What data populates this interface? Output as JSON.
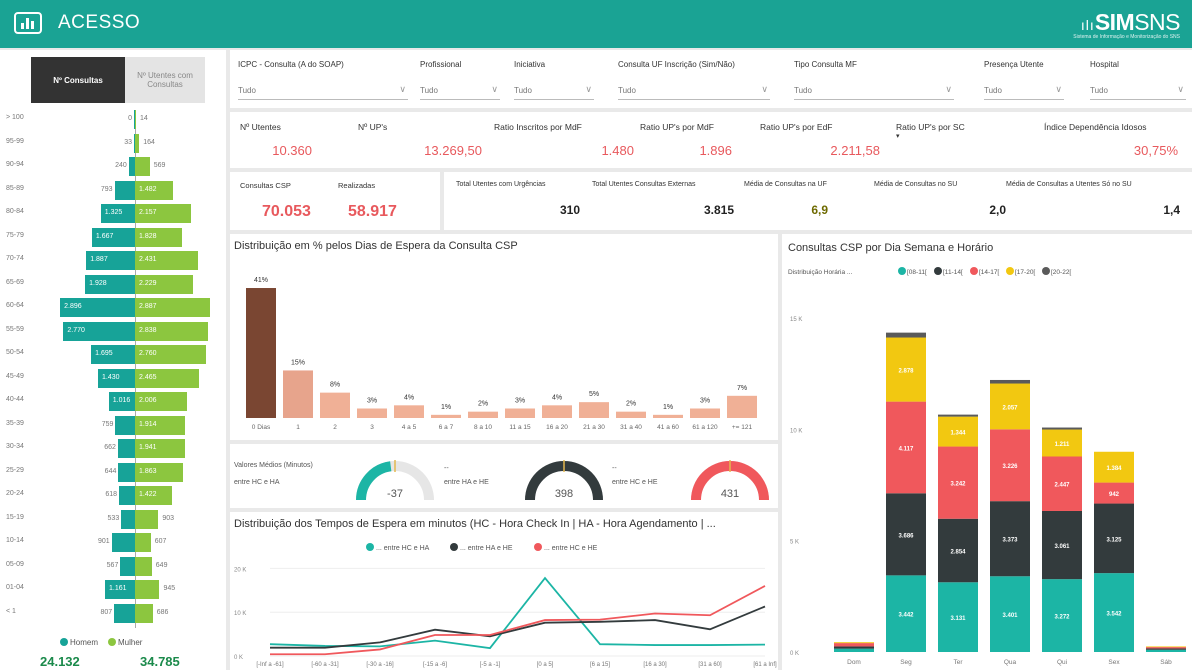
{
  "header": {
    "title": "ACESSO",
    "brand_bold": "SIM",
    "brand_rest": "SNS",
    "brand_sub": "Sistema de Informação e Monitorização do SNS"
  },
  "toggle": {
    "active": "Nº Consultas",
    "inactive": "Nº Utentes com Consultas"
  },
  "pyramid": {
    "rows": [
      {
        "age": "> 100",
        "male": 0,
        "female": 14
      },
      {
        "age": "95-99",
        "male": 33,
        "female": 164
      },
      {
        "age": "90-94",
        "male": 240,
        "female": 569
      },
      {
        "age": "85-89",
        "male": 793,
        "female": 1482
      },
      {
        "age": "80-84",
        "male": 1325,
        "female": 2157
      },
      {
        "age": "75-79",
        "male": 1667,
        "female": 1828
      },
      {
        "age": "70-74",
        "male": 1887,
        "female": 2431
      },
      {
        "age": "65-69",
        "male": 1928,
        "female": 2229
      },
      {
        "age": "60-64",
        "male": 2896,
        "female": 2887
      },
      {
        "age": "55-59",
        "male": 2770,
        "female": 2838
      },
      {
        "age": "50-54",
        "male": 1695,
        "female": 2760
      },
      {
        "age": "45-49",
        "male": 1430,
        "female": 2465
      },
      {
        "age": "40-44",
        "male": 1016,
        "female": 2006
      },
      {
        "age": "35-39",
        "male": 759,
        "female": 1914
      },
      {
        "age": "30-34",
        "male": 662,
        "female": 1941
      },
      {
        "age": "25-29",
        "male": 644,
        "female": 1863
      },
      {
        "age": "20-24",
        "male": 618,
        "female": 1422
      },
      {
        "age": "15-19",
        "male": 533,
        "female": 903
      },
      {
        "age": "10-14",
        "male": 901,
        "female": 607
      },
      {
        "age": "05-09",
        "male": 567,
        "female": 649
      },
      {
        "age": "01-04",
        "male": 1161,
        "female": 945
      },
      {
        "age": "< 1",
        "male": 807,
        "female": 686
      }
    ],
    "legend_male": "Homem",
    "legend_female": "Mulher",
    "total_male": "24.132",
    "total_female": "34.785",
    "male_color": "#17a398",
    "female_color": "#8cc63f"
  },
  "filters": [
    {
      "label": "ICPC - Consulta (A do SOAP)",
      "value": "Tudo"
    },
    {
      "label": "Profissional",
      "value": "Tudo"
    },
    {
      "label": "Iniciativa",
      "value": "Tudo"
    },
    {
      "label": "Consulta UF Inscrição (Sim/Não)",
      "value": "Tudo"
    },
    {
      "label": "Tipo Consulta MF",
      "value": "Tudo"
    },
    {
      "label": "Presença Utente",
      "value": "Tudo"
    },
    {
      "label": "Hospital",
      "value": "Tudo"
    }
  ],
  "kpis1": [
    {
      "label": "Nº Utentes",
      "value": "10.360"
    },
    {
      "label": "Nº UP's",
      "value": "13.269,50"
    },
    {
      "label": "Ratio Inscritos por MdF",
      "value": "1.480"
    },
    {
      "label": "Ratio UP's por MdF",
      "value": "1.896"
    },
    {
      "label": "Ratio UP's por EdF",
      "value": "2.211,58"
    },
    {
      "label": "Ratio UP's por SC",
      "value": ""
    },
    {
      "label": "Índice Dependência Idosos",
      "value": "30,75%"
    }
  ],
  "kpis2": [
    {
      "label": "Consultas CSP",
      "value": "70.053"
    },
    {
      "label": "Realizadas",
      "value": "58.917"
    }
  ],
  "kpis3": [
    {
      "label": "Total Utentes com Urgências",
      "value": "310"
    },
    {
      "label": "Total Utentes Consultas Externas",
      "value": "3.815"
    },
    {
      "label": "Média de Consultas na UF",
      "value": "6,9"
    },
    {
      "label": "Média de Consultas no SU",
      "value": "2,0"
    },
    {
      "label": "Média de Consultas a Utentes Só no SU",
      "value": "1,4"
    }
  ],
  "wait_dist": {
    "title": "Distribuição em % pelos Dias de Espera da Consulta CSP"
  },
  "gauges": {
    "label": "Valores Médios (Minutos)",
    "items": [
      {
        "name": "entre HC e HA",
        "value": "-37",
        "color": "#1cb5a5",
        "level": 0.46
      },
      {
        "name": "entre HA e HE",
        "value": "398",
        "color": "#333b3d",
        "level": 1.0
      },
      {
        "name": "entre HC e HE",
        "value": "431",
        "color": "#f0585c",
        "level": 1.0
      }
    ]
  },
  "line_title": "Distribuição dos Tempos de Espera em minutos (HC - Hora Check In | HA - Hora Agendamento | ...",
  "weekly_title": "Consultas CSP por Dia Semana e Horário",
  "weekly_legend_label": "Distribuição Horária ...",
  "chart_data": [
    {
      "type": "bar",
      "categories": [
        "0 Dias",
        "1",
        "2",
        "3",
        "4 a 5",
        "6 a 7",
        "8 a 10",
        "11 a 15",
        "16 a 20",
        "21 a 30",
        "31 a 40",
        "41 a 60",
        "61 a 120",
        "+= 121"
      ],
      "values": [
        41,
        15,
        8,
        3,
        4,
        1,
        2,
        3,
        4,
        5,
        2,
        1,
        3,
        7
      ],
      "labels": [
        "41%",
        "15%",
        "8%",
        "3%",
        "4%",
        "1%",
        "2%",
        "3%",
        "4%",
        "5%",
        "2%",
        "1%",
        "3%",
        "7%"
      ],
      "colors": {
        "first": "#7a4632",
        "second": "#e7a48c",
        "rest": "#f0b096"
      }
    },
    {
      "type": "line",
      "x": [
        "[-Inf a -61]",
        "[-60 a -31]",
        "[-30 a -16]",
        "[-15 a -6]",
        "[-5 a -1]",
        "[0 a 5]",
        "[6 a 15]",
        "[16 a 30]",
        "[31 a 60]",
        "[61 a Inf]"
      ],
      "ylabels": [
        "20 K",
        "10 K",
        "0 K"
      ],
      "ylim": [
        0,
        21000
      ],
      "series": [
        {
          "name": "entre HC e HA",
          "color": "#1cb5a5",
          "values": [
            2700,
            2300,
            2200,
            3500,
            1800,
            17800,
            2700,
            2500,
            2500,
            2600
          ]
        },
        {
          "name": "entre HA e HE",
          "color": "#333b3d",
          "values": [
            1900,
            1900,
            3100,
            6000,
            4500,
            7600,
            7800,
            8200,
            6100,
            11300
          ]
        },
        {
          "name": "entre HC e HE",
          "color": "#f0585c",
          "values": [
            400,
            400,
            1500,
            4800,
            4800,
            8200,
            8300,
            9700,
            9300,
            16000
          ]
        }
      ]
    },
    {
      "type": "bar",
      "stacked": true,
      "categories": [
        "Dom",
        "Seg",
        "Ter",
        "Qua",
        "Qui",
        "Sex",
        "Sáb"
      ],
      "ylabels": [
        "15 K",
        "10 K",
        "5 K",
        "0 K"
      ],
      "ylim": [
        0,
        15000
      ],
      "series": [
        {
          "name": "[08-11[",
          "color": "#1cb5a5",
          "values": [
            150,
            3442,
            3131,
            3401,
            3272,
            3542,
            100
          ],
          "labels": [
            "",
            "3.442",
            "3.131",
            "3.401",
            "3.272",
            "3.542",
            ""
          ]
        },
        {
          "name": "[11-14[",
          "color": "#333b3d",
          "values": [
            100,
            3686,
            2854,
            3373,
            3061,
            3125,
            60
          ],
          "labels": [
            "",
            "3.686",
            "2.854",
            "3.373",
            "3.061",
            "3.125",
            ""
          ]
        },
        {
          "name": "[14-17[",
          "color": "#f0585c",
          "values": [
            150,
            4117,
            3242,
            3226,
            2447,
            942,
            60
          ],
          "labels": [
            "",
            "4.117",
            "3.242",
            "3.226",
            "2.447",
            "942",
            ""
          ]
        },
        {
          "name": "[17-20[",
          "color": "#f2c811",
          "values": [
            40,
            2878,
            1344,
            2057,
            1211,
            1384,
            30
          ],
          "labels": [
            "",
            "2.878",
            "1.344",
            "2.057",
            "1.211",
            "1.384",
            ""
          ]
        },
        {
          "name": "[20-22[",
          "color": "#5a5a5a",
          "values": [
            0,
            220,
            90,
            160,
            90,
            0,
            0
          ],
          "labels": [
            "",
            "",
            "",
            "",
            "",
            "",
            ""
          ]
        }
      ]
    }
  ]
}
